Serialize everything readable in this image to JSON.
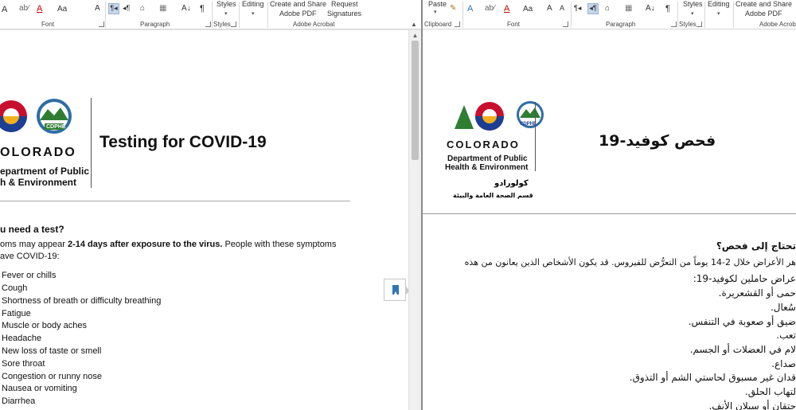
{
  "left_ribbon": {
    "styles_label": "Styles",
    "editing_label": "Editing",
    "create_share_label_1": "Create and Share",
    "create_share_label_2": "Adobe PDF",
    "request_sig_label_1": "Request",
    "request_sig_label_2": "Signatures",
    "groups": {
      "font": "Font",
      "paragraph": "Paragraph",
      "styles": "Styles",
      "acrobat": "Adobe Acrobat"
    },
    "aa_label": "Aa",
    "pilcrow": "¶"
  },
  "right_ribbon": {
    "paste_label": "Paste",
    "styles_label": "Styles",
    "editing_label": "Editing",
    "create_share_label_1": "Create and Share",
    "create_share_label_2": "Adobe PDF",
    "groups": {
      "clipboard": "Clipboard",
      "font": "Font",
      "paragraph": "Paragraph",
      "styles": "Styles",
      "acrobat": "Adobe Acrob"
    },
    "aa_label": "Aa",
    "pilcrow": "¶"
  },
  "left_doc": {
    "logo_colorado": "OLORADO",
    "logo_cdphe": "CDPHE",
    "logo_dept_1": "epartment of Public",
    "logo_dept_2": "h & Environment",
    "title": "Testing for COVID-19",
    "heading": "u need a test?",
    "para1_start": "oms may appear ",
    "para1_bold": "2-14 days after exposure to the virus.",
    "para1_end": " People with these symptoms",
    "para2": "ave COVID-19:",
    "symptoms": [
      "Fever or chills",
      "Cough",
      "Shortness of breath or difficulty breathing",
      "Fatigue",
      "Muscle or body aches",
      "Headache",
      "New loss of taste or smell",
      "Sore throat",
      "Congestion or runny nose",
      "Nausea or vomiting",
      "Diarrhea"
    ]
  },
  "right_doc": {
    "logo_colorado": "COLORADO",
    "logo_cdphe": "CDPHE",
    "logo_dept_1": "Department of Public",
    "logo_dept_2": "Health & Environment",
    "logo_ar_1": "كولورادو",
    "logo_ar_2": "قسم الصحة العامة والبيئة",
    "title": "فحص كوفيد-19",
    "heading": "تحتاج إلى فحص؟",
    "lines": [
      "هر الأعراض خلال 2-14 يوماً من التعرُّض للفيروس. قد يكون الأشخاص الذين يعانون من هذه",
      "عراض حاملين لكوفيد-19:",
      "حمى أو القشعريرة.",
      "سُعال.",
      "ضيق أو صعوبة في التنفس.",
      "تعب.",
      "لام في العضلات أو الجسم.",
      "صداع.",
      "قدان غير مسبوق لحاستي الشم أو التذوق.",
      "لتهاب الحلق.",
      "حتقان أو سيلان الأنف."
    ]
  },
  "colors": {
    "logo_red": "#c8102e",
    "logo_blue": "#1c3f94",
    "logo_yellow": "#f3b01c",
    "logo_green": "#2e7d32",
    "accent": "#2e75b6"
  }
}
